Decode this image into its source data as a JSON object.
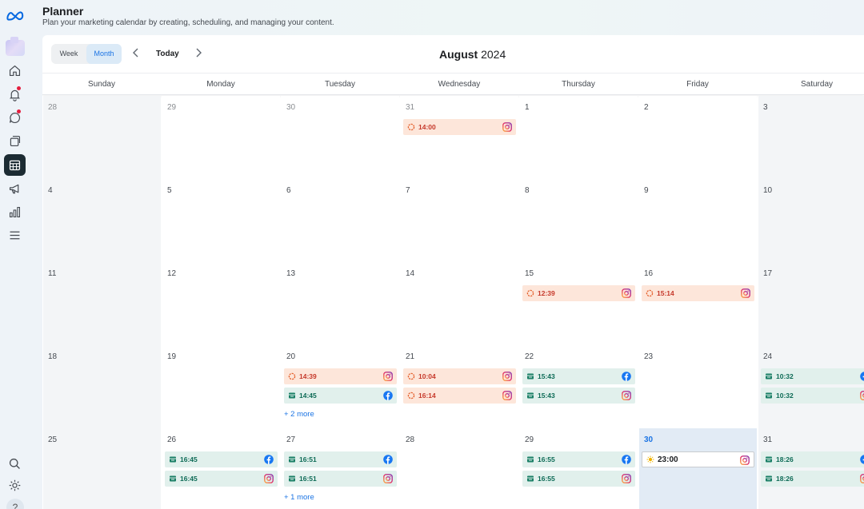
{
  "header": {
    "title": "Planner",
    "subtitle": "Plan your marketing calendar by creating, scheduling, and managing your content."
  },
  "sidebar": {
    "items": [
      {
        "name": "meta-logo-icon",
        "active": false
      },
      {
        "name": "home-icon",
        "active": false
      },
      {
        "name": "notifications-icon",
        "active": false,
        "badge": true
      },
      {
        "name": "inbox-icon",
        "active": false,
        "badge": true
      },
      {
        "name": "content-icon",
        "active": false
      },
      {
        "name": "planner-icon",
        "active": true
      },
      {
        "name": "ads-icon",
        "active": false
      },
      {
        "name": "insights-icon",
        "active": false
      },
      {
        "name": "menu-icon",
        "active": false
      },
      {
        "name": "search-icon",
        "active": false
      },
      {
        "name": "settings-icon",
        "active": false
      },
      {
        "name": "help-icon",
        "active": false
      }
    ],
    "help_label": "?"
  },
  "toolbar": {
    "week_label": "Week",
    "month_label": "Month",
    "selected_view": "Month",
    "today_label": "Today",
    "month_name": "August",
    "year": "2024"
  },
  "weekdays": [
    "Sunday",
    "Monday",
    "Tuesday",
    "Wednesday",
    "Thursday",
    "Friday",
    "Saturday"
  ],
  "colors": {
    "accent": "#1b74e4",
    "draft_bg": "#fde6da",
    "draft_text": "#c6392b",
    "scheduled_bg": "#e1f0ec",
    "scheduled_text": "#0c6a55",
    "facebook": "#1877f2",
    "instagram": "#d6249f"
  },
  "weeks": [
    [
      {
        "day": "28",
        "muted": true,
        "events": []
      },
      {
        "day": "29",
        "muted": true,
        "events": []
      },
      {
        "day": "30",
        "muted": true,
        "events": []
      },
      {
        "day": "31",
        "muted": true,
        "events": [
          {
            "time": "14:00",
            "status": "draft",
            "network": "instagram"
          }
        ]
      },
      {
        "day": "1",
        "events": []
      },
      {
        "day": "2",
        "events": []
      },
      {
        "day": "3",
        "events": []
      }
    ],
    [
      {
        "day": "4",
        "events": []
      },
      {
        "day": "5",
        "events": []
      },
      {
        "day": "6",
        "events": []
      },
      {
        "day": "7",
        "events": []
      },
      {
        "day": "8",
        "events": []
      },
      {
        "day": "9",
        "events": []
      },
      {
        "day": "10",
        "events": []
      }
    ],
    [
      {
        "day": "11",
        "events": []
      },
      {
        "day": "12",
        "events": []
      },
      {
        "day": "13",
        "events": []
      },
      {
        "day": "14",
        "events": []
      },
      {
        "day": "15",
        "events": [
          {
            "time": "12:39",
            "status": "draft",
            "network": "instagram"
          }
        ]
      },
      {
        "day": "16",
        "events": [
          {
            "time": "15:14",
            "status": "draft",
            "network": "instagram"
          }
        ]
      },
      {
        "day": "17",
        "events": []
      }
    ],
    [
      {
        "day": "18",
        "events": []
      },
      {
        "day": "19",
        "events": []
      },
      {
        "day": "20",
        "events": [
          {
            "time": "14:39",
            "status": "draft",
            "network": "instagram"
          },
          {
            "time": "14:45",
            "status": "scheduled",
            "network": "facebook"
          }
        ],
        "more": "+ 2 more"
      },
      {
        "day": "21",
        "events": [
          {
            "time": "10:04",
            "status": "draft",
            "network": "instagram"
          },
          {
            "time": "16:14",
            "status": "draft",
            "network": "instagram"
          }
        ]
      },
      {
        "day": "22",
        "events": [
          {
            "time": "15:43",
            "status": "scheduled",
            "network": "facebook"
          },
          {
            "time": "15:43",
            "status": "scheduled",
            "network": "instagram"
          }
        ]
      },
      {
        "day": "23",
        "events": []
      },
      {
        "day": "24",
        "events": [
          {
            "time": "10:32",
            "status": "scheduled",
            "network": "facebook"
          },
          {
            "time": "10:32",
            "status": "scheduled",
            "network": "instagram"
          }
        ]
      }
    ],
    [
      {
        "day": "25",
        "events": []
      },
      {
        "day": "26",
        "events": [
          {
            "time": "16:45",
            "status": "scheduled",
            "network": "facebook"
          },
          {
            "time": "16:45",
            "status": "scheduled",
            "network": "instagram"
          }
        ]
      },
      {
        "day": "27",
        "events": [
          {
            "time": "16:51",
            "status": "scheduled",
            "network": "facebook"
          },
          {
            "time": "16:51",
            "status": "scheduled",
            "network": "instagram"
          }
        ],
        "more": "+ 1 more"
      },
      {
        "day": "28",
        "events": []
      },
      {
        "day": "29",
        "events": [
          {
            "time": "16:55",
            "status": "scheduled",
            "network": "facebook"
          },
          {
            "time": "16:55",
            "status": "scheduled",
            "network": "instagram"
          }
        ]
      },
      {
        "day": "30",
        "today": true,
        "events": [
          {
            "time": "23:00",
            "status": "now",
            "network": "instagram"
          }
        ]
      },
      {
        "day": "31",
        "events": [
          {
            "time": "18:26",
            "status": "scheduled",
            "network": "facebook"
          },
          {
            "time": "18:26",
            "status": "scheduled",
            "network": "instagram"
          }
        ]
      }
    ]
  ]
}
